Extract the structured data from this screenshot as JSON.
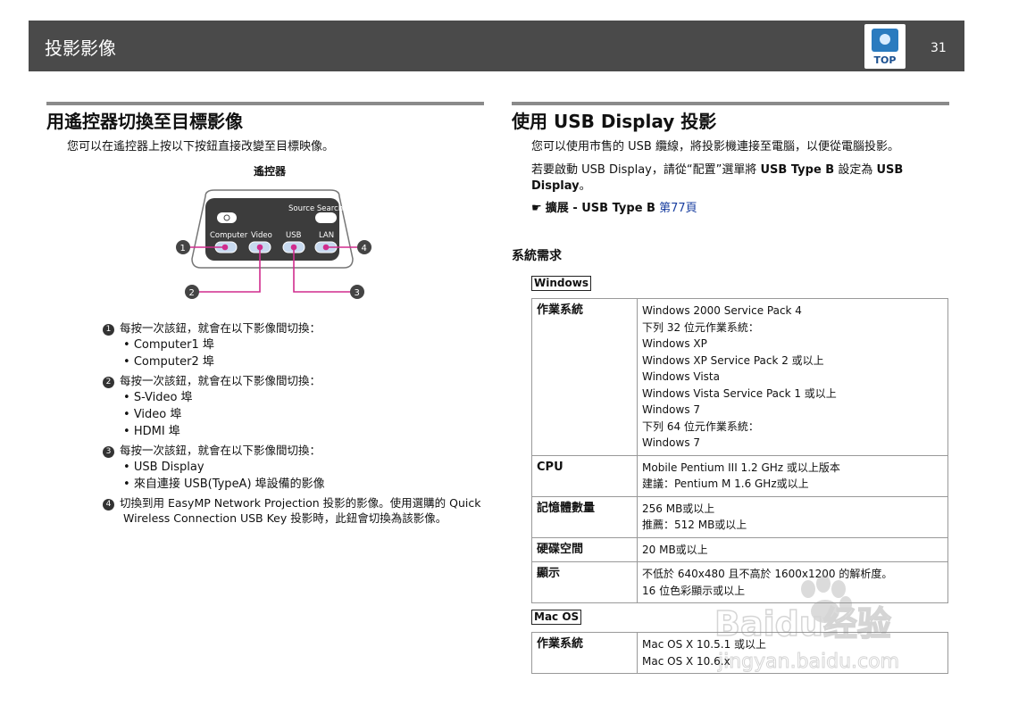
{
  "header": {
    "section_title": "投影影像",
    "top_label": "TOP",
    "page_number": "31"
  },
  "left": {
    "heading": "用遙控器切換至目標影像",
    "intro": "您可以在遙控器上按以下按鈕直接改變至目標映像。",
    "diagram_caption": "遙控器",
    "remote": {
      "source_search": "Source Search",
      "buttons": [
        "Computer",
        "Video",
        "USB",
        "LAN"
      ],
      "callouts": [
        "1",
        "2",
        "3",
        "4"
      ]
    },
    "items": [
      {
        "num": "1",
        "text": "每按一次該鈕，就會在以下影像間切換：",
        "bullets": [
          "Computer1 埠",
          "Computer2 埠"
        ]
      },
      {
        "num": "2",
        "text": "每按一次該鈕，就會在以下影像間切換：",
        "bullets": [
          "S-Video 埠",
          "Video 埠",
          "HDMI 埠"
        ]
      },
      {
        "num": "3",
        "text": "每按一次該鈕，就會在以下影像間切換：",
        "bullets": [
          "USB Display",
          "來自連接 USB(TypeA) 埠設備的影像"
        ]
      },
      {
        "num": "4",
        "text_line1": "切換到用 EasyMP Network Projection 投影的影像。使用選購的 Quick",
        "text_line2": "Wireless Connection USB Key 投影時，此鈕會切換為該影像。"
      }
    ]
  },
  "right": {
    "heading": "使用 USB Display 投影",
    "p1": "您可以使用市售的 USB 纜線，將投影機連接至電腦，以便從電腦投影。",
    "p2_a": "若要啟動 USB Display，請從“配置”選單將 ",
    "p2_b": "USB Type B",
    "p2_c": " 設定為 ",
    "p2_d": "USB",
    "p2_e": "Display",
    "p2_f": "。",
    "ref_bold": "擴展 - USB Type B",
    "ref_link": "第77頁",
    "sysreq_heading": "系統需求",
    "windows_label": "Windows",
    "windows_table": [
      {
        "key": "作業系統",
        "values": [
          "Windows 2000 Service Pack 4",
          "下列 32 位元作業系統：",
          "Windows XP",
          "Windows XP Service Pack 2 或以上",
          "Windows Vista",
          "Windows Vista Service Pack 1 或以上",
          "Windows 7",
          "下列 64 位元作業系統：",
          "Windows 7"
        ]
      },
      {
        "key": "CPU",
        "values": [
          "Mobile Pentium III 1.2 GHz 或以上版本",
          "建議：Pentium M 1.6 GHz或以上"
        ]
      },
      {
        "key": "記憶體數量",
        "values": [
          "256 MB或以上",
          "推薦：512 MB或以上"
        ]
      },
      {
        "key": "硬碟空間",
        "values": [
          "20 MB或以上"
        ]
      },
      {
        "key": "顯示",
        "values": [
          "不低於 640x480 且不高於 1600x1200 的解析度。",
          "16 位色彩顯示或以上"
        ]
      }
    ],
    "mac_label": "Mac OS",
    "mac_table": [
      {
        "key": "作業系統",
        "values": [
          "Mac OS X 10.5.1 或以上",
          "Mac OS X 10.6.x"
        ]
      }
    ]
  },
  "watermark": {
    "text": "Baidu经验",
    "url_text": "jingyan.baidu.com"
  }
}
